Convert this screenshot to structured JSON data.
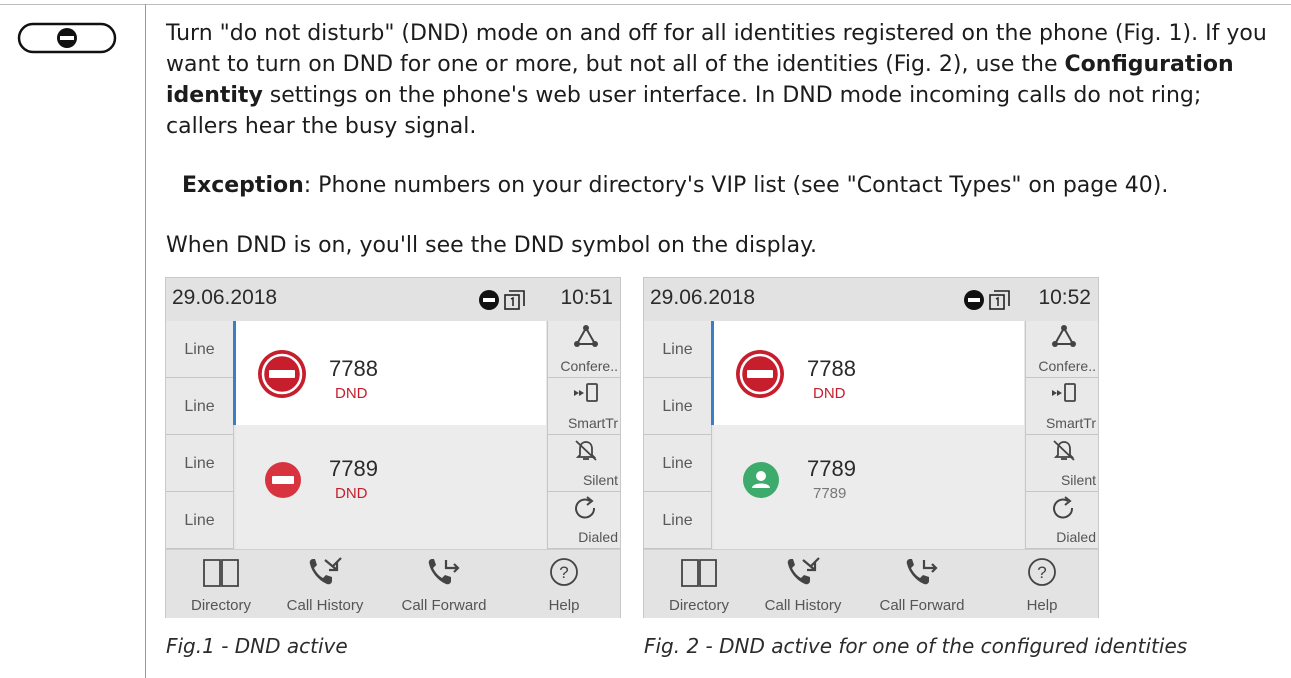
{
  "doc": {
    "paragraph1_before": "Turn \"do not disturb\" (DND) mode on and off for all identities registered on the phone (Fig. 1).  If you want to turn on DND for one or more, but not all of the identities (Fig. 2), use the ",
    "paragraph1_bold": "Configuration identity",
    "paragraph1_after": " settings on the phone's web user interface.  In DND mode incoming calls do not ring; callers hear the busy signal.",
    "exception_label": "Exception",
    "exception_text": ":  Phone numbers on your directory's VIP list (see \"Contact Types\" on page 40).",
    "paragraph3": "When DND is on, you'll see the DND symbol on the display."
  },
  "figure1": {
    "date": "29.06.2018",
    "time": "10:51",
    "line_labels": [
      "Line",
      "Line",
      "Line",
      "Line"
    ],
    "calls": [
      {
        "number": "7788",
        "status": "DND"
      },
      {
        "number": "7789",
        "status": "DND"
      }
    ],
    "softkeys": [
      "Confere..",
      "SmartTr",
      "Silent",
      "Dialed"
    ],
    "bottom": [
      "Directory",
      "Call History",
      "Call Forward",
      "Help"
    ],
    "caption": "Fig.1 - DND active"
  },
  "figure2": {
    "date": "29.06.2018",
    "time": "10:52",
    "line_labels": [
      "Line",
      "Line",
      "Line",
      "Line"
    ],
    "calls": [
      {
        "number": "7788",
        "status": "DND"
      },
      {
        "number": "7789",
        "status": "7789"
      }
    ],
    "softkeys": [
      "Confere..",
      "SmartTr",
      "Silent",
      "Dialed"
    ],
    "bottom": [
      "Directory",
      "Call History",
      "Call Forward",
      "Help"
    ],
    "caption": "Fig. 2 - DND active for one of the configured identities"
  },
  "colors": {
    "dnd_red": "#c61e2d",
    "available_green": "#3dab6c",
    "active_line": "#3a7fc3"
  },
  "icons": [
    "dnd-key-icon",
    "dnd-status-icon",
    "identity-icon",
    "conference-icon",
    "smart-transfer-icon",
    "silent-icon",
    "dialed-icon",
    "directory-icon",
    "call-history-icon",
    "call-forward-icon",
    "help-icon",
    "available-person-icon"
  ]
}
